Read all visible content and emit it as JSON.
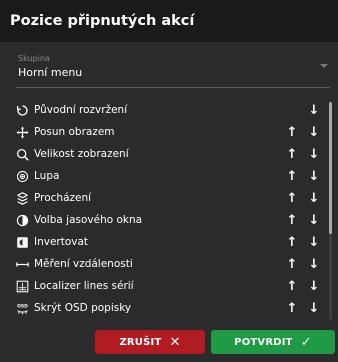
{
  "dialog": {
    "title": "Pozice připnutých akcí",
    "group_select": {
      "label": "Skupina",
      "value": "Horní menu"
    },
    "items": [
      {
        "label": "Původní rozvržení",
        "icon": "reset-icon",
        "has_up": false,
        "has_down": true
      },
      {
        "label": "Posun obrazem",
        "icon": "pan-icon",
        "has_up": true,
        "has_down": true
      },
      {
        "label": "Velikost zobrazení",
        "icon": "zoom-icon",
        "has_up": true,
        "has_down": true
      },
      {
        "label": "Lupa",
        "icon": "magnifier-icon",
        "has_up": true,
        "has_down": true
      },
      {
        "label": "Procházení",
        "icon": "scroll-stack-icon",
        "has_up": true,
        "has_down": true
      },
      {
        "label": "Volba jasového okna",
        "icon": "contrast-icon",
        "has_up": true,
        "has_down": true
      },
      {
        "label": "Invertovat",
        "icon": "invert-icon",
        "has_up": true,
        "has_down": true
      },
      {
        "label": "Měření vzdálenosti",
        "icon": "ruler-line-icon",
        "has_up": true,
        "has_down": true
      },
      {
        "label": "Localizer lines sérií",
        "icon": "localizer-lines-icon",
        "has_up": true,
        "has_down": true
      },
      {
        "label": "Skrýt OSD popisky",
        "icon": "osd-hide-icon",
        "has_up": true,
        "has_down": true
      }
    ],
    "buttons": {
      "cancel": "ZRUŠIT",
      "confirm": "POTVRDIT"
    },
    "colors": {
      "cancel": "#b11b22",
      "confirm": "#1f9a45",
      "background": "#2b2b2b",
      "header": "#1a1a1a"
    }
  }
}
